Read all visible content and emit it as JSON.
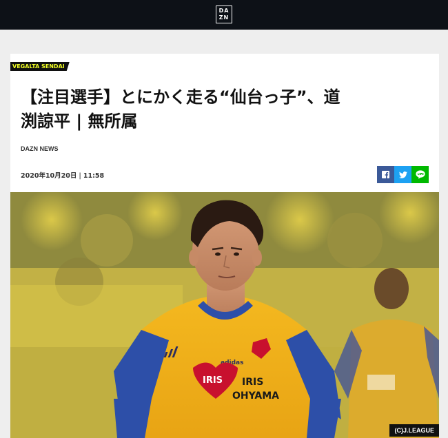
{
  "header": {
    "logo_text_top": "DA",
    "logo_text_bottom": "ZN"
  },
  "article": {
    "category_tag": "VEGALTA SENDAI",
    "title_line1": "【注目選手】とにかく走る“仙台っ子”、道",
    "title_line2": "渕諒平 | 無所属",
    "author": "DAZN NEWS",
    "date": "2020年10月20日",
    "time": "11:58",
    "date_separator": "|"
  },
  "share": [
    {
      "name": "facebook",
      "icon": "facebook-icon",
      "color": "#3b5998"
    },
    {
      "name": "twitter",
      "icon": "twitter-icon",
      "color": "#1da1f2"
    },
    {
      "name": "line",
      "icon": "line-icon",
      "color": "#00b900"
    }
  ],
  "photo": {
    "credit": "(C)J.LEAGUE",
    "sponsor_line1": "IRIS",
    "sponsor_line2": "OHYAMA",
    "heart_text": "IRIS",
    "kit_brand": "adidas"
  },
  "colors": {
    "topbar": "#0d1117",
    "tag_text": "#f2ff26",
    "jersey_gold": "#f2b21a",
    "sleeve_blue": "#2d4fa8"
  }
}
